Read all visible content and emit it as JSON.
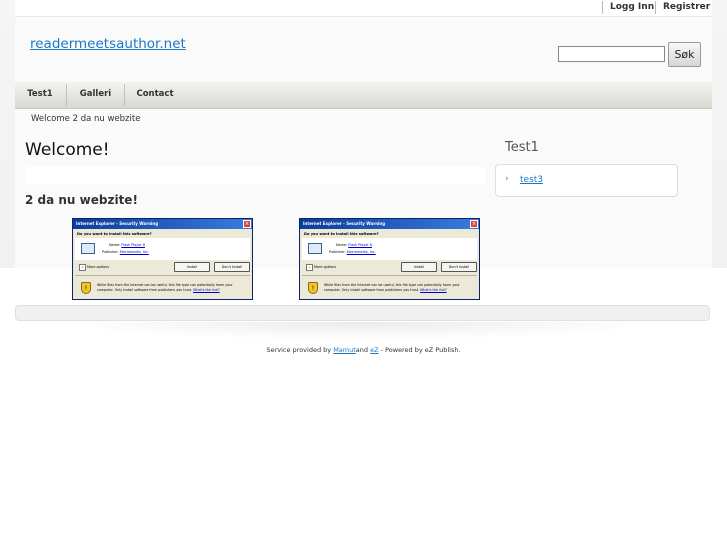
{
  "header": {
    "links": [
      "Logg Inn",
      "Registrer"
    ],
    "site_title": "readermeetsauthor.net",
    "search": {
      "value": "",
      "button_label": "Søk"
    }
  },
  "nav": {
    "items": [
      "Test1",
      "Galleri",
      "Contact"
    ]
  },
  "breadcrumb": "Welcome 2 da nu webzite",
  "main": {
    "heading": "Welcome!",
    "subheading": "2 da nu webzite!",
    "images": [
      {
        "title": "Internet Explorer - Security Warning",
        "question": "Do you want to install this software?",
        "name_label": "Name:",
        "name_value": "Flash Player 8",
        "publisher_label": "Publisher:",
        "publisher_value": "Macromedia, Inc.",
        "more": "More options",
        "install": "Install",
        "dont_install": "Don't Install",
        "warning": "While files from the Internet can be useful, this file type can potentially harm your computer. Only install software from publishers you trust.",
        "risk_link": "What's the risk?"
      },
      {
        "title": "Internet Explorer - Security Warning",
        "question": "Do you want to install this software?",
        "name_label": "Name:",
        "name_value": "Flash Player 8",
        "publisher_label": "Publisher:",
        "publisher_value": "Macromedia, Inc.",
        "more": "More options",
        "install": "Install",
        "dont_install": "Don't Install",
        "warning": "While files from the Internet can be useful, this file type can potentially harm your computer. Only install software from publishers you trust.",
        "risk_link": "What's the risk?"
      }
    ]
  },
  "sidebar": {
    "heading": "Test1",
    "items": [
      "test3"
    ]
  },
  "footer": {
    "prefix": "Service provided by",
    "link1": "Mamut",
    "and": "and",
    "link2": "eZ",
    "suffix": "- Powered by eZ Publish."
  }
}
